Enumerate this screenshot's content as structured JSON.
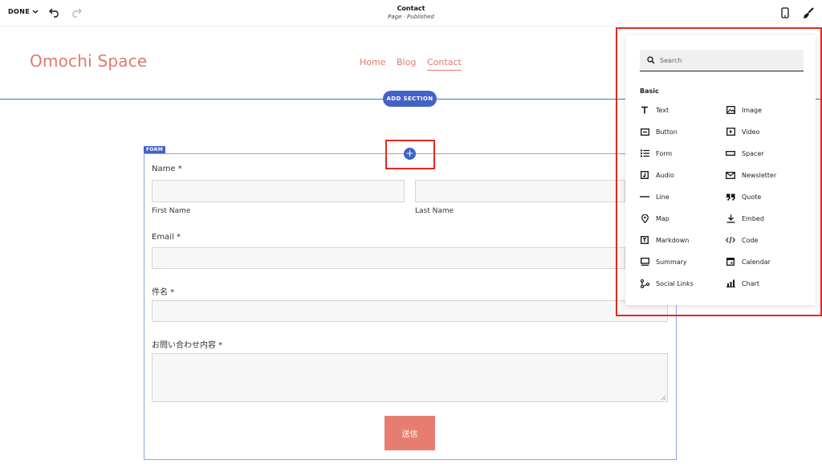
{
  "toolbar": {
    "done_label": "DONE",
    "page_title": "Contact",
    "page_status": "Page · Published"
  },
  "site": {
    "title": "Omochi Space",
    "nav": [
      {
        "label": "Home"
      },
      {
        "label": "Blog"
      },
      {
        "label": "Contact",
        "active": true
      }
    ],
    "add_section_label": "ADD SECTION"
  },
  "form": {
    "tag": "FORM",
    "plus_symbol": "+",
    "name_label": "Name *",
    "first_name_label": "First Name",
    "last_name_label": "Last Name",
    "email_label": "Email *",
    "subject_label": "件名 *",
    "message_label": "お問い合わせ内容 *",
    "submit_label": "送信"
  },
  "panel": {
    "search_placeholder": "Search",
    "section_heading": "Basic",
    "items_left": [
      {
        "label": "Text",
        "icon": "text-icon"
      },
      {
        "label": "Button",
        "icon": "button-icon"
      },
      {
        "label": "Form",
        "icon": "form-icon"
      },
      {
        "label": "Audio",
        "icon": "audio-icon"
      },
      {
        "label": "Line",
        "icon": "line-icon"
      },
      {
        "label": "Map",
        "icon": "map-pin-icon"
      },
      {
        "label": "Markdown",
        "icon": "markdown-icon"
      },
      {
        "label": "Summary",
        "icon": "summary-icon"
      },
      {
        "label": "Social Links",
        "icon": "social-links-icon"
      }
    ],
    "items_right": [
      {
        "label": "Image",
        "icon": "image-icon"
      },
      {
        "label": "Video",
        "icon": "video-icon"
      },
      {
        "label": "Spacer",
        "icon": "spacer-icon"
      },
      {
        "label": "Newsletter",
        "icon": "newsletter-icon"
      },
      {
        "label": "Quote",
        "icon": "quote-icon"
      },
      {
        "label": "Embed",
        "icon": "embed-icon"
      },
      {
        "label": "Code",
        "icon": "code-icon"
      },
      {
        "label": "Calendar",
        "icon": "calendar-icon"
      },
      {
        "label": "Chart",
        "icon": "chart-icon"
      }
    ]
  },
  "colors": {
    "brand": "#e3796b",
    "editor_accent": "#4262c8",
    "highlight": "#e5271f"
  }
}
